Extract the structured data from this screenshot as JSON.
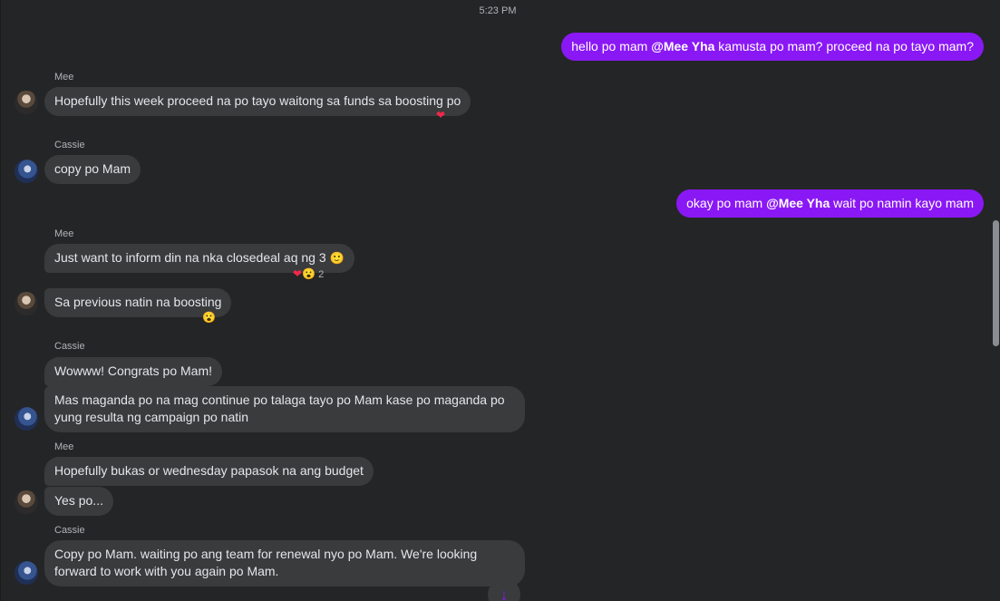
{
  "timestamp": "5:23 PM",
  "colors": {
    "outgoing_bubble": "#8a18f5",
    "incoming_bubble": "#3a3b3c",
    "background": "#242526"
  },
  "outgoing": [
    {
      "prefix": "hello po mam ",
      "mention": "@Mee Yha",
      "suffix": " kamusta po mam? proceed na po tayo mam?"
    },
    {
      "prefix": "okay po mam ",
      "mention": "@Mee Yha",
      "suffix": " wait po namin kayo mam"
    }
  ],
  "senders": {
    "mee": "Mee",
    "cassie": "Cassie"
  },
  "incoming": {
    "m1": "Hopefully this week proceed na po tayo waitong sa funds sa boosting po",
    "m2": "copy po Mam",
    "m3": "Just want to inform din na nka closedeal aq ng 3",
    "m4": "Sa previous natin na boosting",
    "m5": "Wowww! Congrats po Mam!",
    "m6": "Mas maganda po na mag continue po talaga tayo po Mam kase po maganda po yung resulta ng campaign po natin",
    "m7": "Hopefully bukas or wednesday papasok na ang budget",
    "m8": "Yes po...",
    "m9": "Copy po Mam. waiting po ang team for renewal nyo po Mam. We're looking forward to work with you again po Mam."
  },
  "reactions": {
    "m1": {
      "icons": [
        "heart-icon"
      ]
    },
    "m3": {
      "icons": [
        "heart-icon",
        "wow-icon"
      ],
      "count": "2"
    },
    "m4": {
      "icons": [
        "wow-icon"
      ]
    }
  },
  "glyphs": {
    "heart": "❤",
    "wow": "😮",
    "smile": "🙂",
    "arrow_down": "↓"
  }
}
